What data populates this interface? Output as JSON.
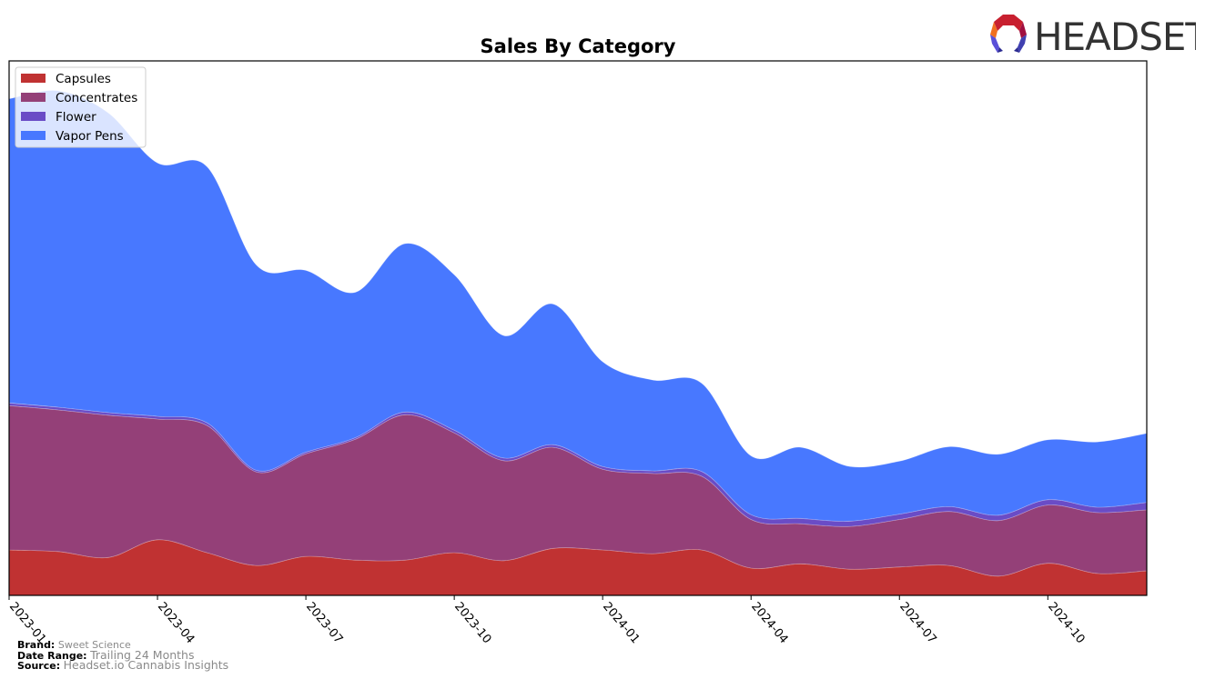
{
  "header": {
    "logo_text": "HEADSET"
  },
  "footer": {
    "brand_label": "Brand:",
    "brand_value": "Sweet Science",
    "date_range_label": "Date Range:",
    "date_range_value": "Trailing 24 Months",
    "source_label": "Source:",
    "source_value": "Headset.io Cannabis Insights"
  },
  "chart_data": {
    "type": "area",
    "stacked": true,
    "title": "Sales By Category",
    "xlabel": "",
    "ylabel": "",
    "y_units": "relative (0-100 of plot height, no y-axis shown)",
    "ylim": [
      0,
      100
    ],
    "legend_position": "top-left",
    "grid": false,
    "x": [
      "2023-01",
      "2023-02",
      "2023-03",
      "2023-04",
      "2023-05",
      "2023-06",
      "2023-07",
      "2023-08",
      "2023-09",
      "2023-10",
      "2023-11",
      "2023-12",
      "2024-01",
      "2024-02",
      "2024-03",
      "2024-04",
      "2024-05",
      "2024-06",
      "2024-07",
      "2024-08",
      "2024-09",
      "2024-10",
      "2024-11",
      "2024-12"
    ],
    "x_tick_labels": [
      "2023-01",
      "2023-04",
      "2023-07",
      "2023-10",
      "2024-01",
      "2024-04",
      "2024-07",
      "2024-10"
    ],
    "series": [
      {
        "name": "Capsules",
        "color": "#c03232",
        "values": [
          8.5,
          8.2,
          7.1,
          10.4,
          8.0,
          5.6,
          7.3,
          6.6,
          6.6,
          8.0,
          6.5,
          8.8,
          8.5,
          7.8,
          8.5,
          5.1,
          5.9,
          4.9,
          5.3,
          5.6,
          3.6,
          6.0,
          4.1,
          4.6
        ]
      },
      {
        "name": "Concentrates",
        "color": "#944078",
        "values": [
          27.0,
          26.5,
          26.6,
          22.6,
          23.8,
          17.5,
          19.2,
          22.6,
          27.2,
          22.4,
          18.7,
          18.9,
          15.1,
          15.0,
          13.8,
          9.1,
          7.5,
          8.0,
          8.9,
          10.1,
          10.4,
          10.9,
          11.4,
          11.4
        ]
      },
      {
        "name": "Flower",
        "color": "#6a4cc6",
        "values": [
          0.5,
          0.5,
          0.5,
          0.5,
          0.5,
          0.3,
          0.3,
          0.3,
          0.5,
          0.5,
          0.5,
          0.5,
          0.5,
          0.5,
          0.9,
          0.9,
          1.0,
          1.0,
          1.0,
          0.9,
          1.0,
          1.0,
          1.0,
          1.4
        ]
      },
      {
        "name": "Vapor Pens",
        "color": "#4878ff",
        "values": [
          56.9,
          59.2,
          56.1,
          47.4,
          47.9,
          38.4,
          34.0,
          27.2,
          31.5,
          29.1,
          22.9,
          26.3,
          19.6,
          17.0,
          16.5,
          11.0,
          13.3,
          10.2,
          9.9,
          11.2,
          11.4,
          11.2,
          12.2,
          12.9
        ]
      }
    ]
  }
}
